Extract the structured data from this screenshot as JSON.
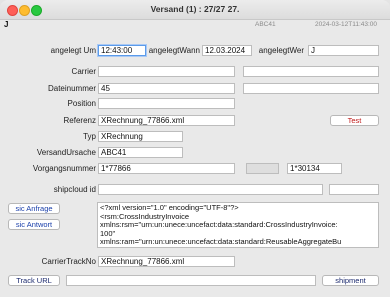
{
  "window": {
    "title": "Versand (1) : 27/27 27."
  },
  "header": {
    "code": "ABC41",
    "timestamp": "2024-03-12T11:43:00",
    "j_marker": "J"
  },
  "form": {
    "angelegt_um": {
      "label": "angelegt Um",
      "value": "12:43:00"
    },
    "angelegt_wann": {
      "label": "angelegtWann",
      "value": "12.03.2024"
    },
    "angelegt_wer": {
      "label": "angelegtWer",
      "value": "J"
    },
    "carrier": {
      "label": "Carrier",
      "value": ""
    },
    "dateinummer": {
      "label": "Dateinummer",
      "value": "45"
    },
    "position": {
      "label": "Position",
      "value": ""
    },
    "referenz": {
      "label": "Referenz",
      "value": "XRechnung_77866.xml"
    },
    "typ": {
      "label": "Typ",
      "value": "XRechnung"
    },
    "versand_ursache": {
      "label": "VersandUrsache",
      "value": "ABC41"
    },
    "vorgangsnummer": {
      "label": "Vorgangsnummer",
      "value": "1*77866",
      "value2": "",
      "value3": "1*30134"
    },
    "shipcloud_id": {
      "label": "shipcloud id",
      "value": ""
    },
    "carrier_track_no": {
      "label": "CarrierTrackNo",
      "value": "XRechnung_77866.xml"
    }
  },
  "buttons": {
    "test": "Test",
    "sic_anfrage": "sic Anfrage",
    "sic_antwort": "sic Antwort",
    "track_url": "Track URL",
    "shipment": "shipment"
  },
  "xml_content": {
    "lines": [
      "<?xml version=\"1.0\" encoding=\"UTF-8\"?>",
      "<rsm:CrossIndustryInvoice",
      "xmlns:rsm=\"urn:un:unece:uncefact:data:standard:CrossIndustryInvoice:",
      "100\"",
      "xmlns:ram=\"urn:un:unece:uncefact:data:standard:ReusableAggregateBu"
    ]
  }
}
